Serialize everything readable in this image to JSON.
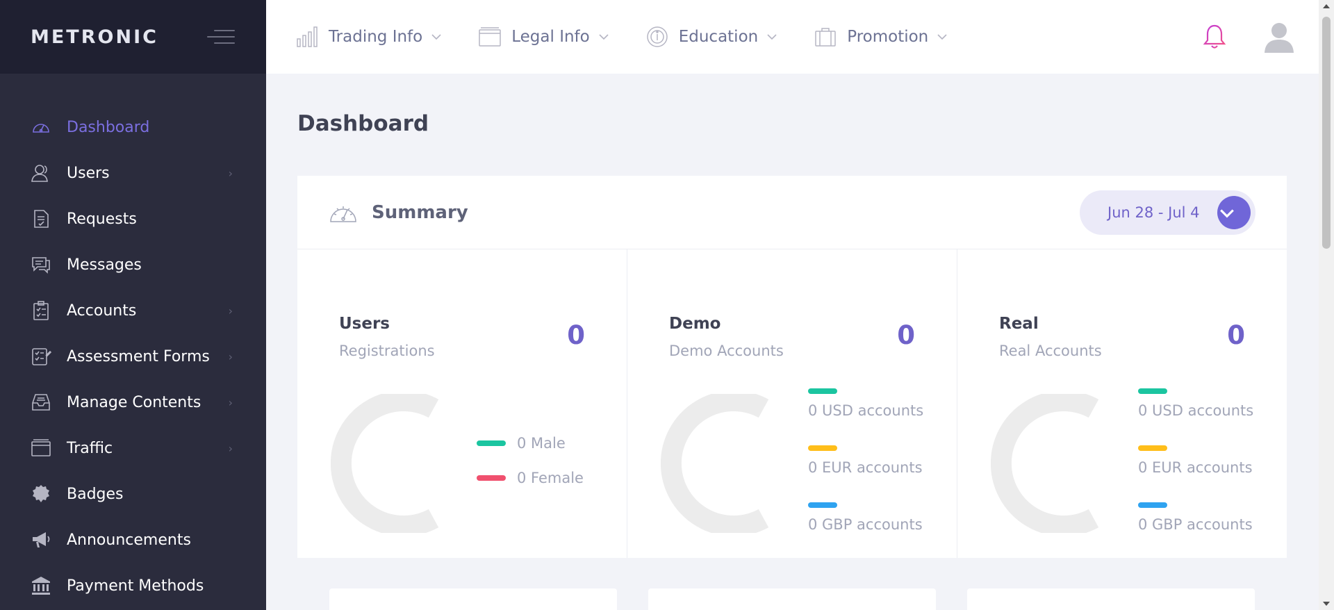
{
  "brand": {
    "name": "METRONIC"
  },
  "sidebar": {
    "items": [
      {
        "label": "Dashboard",
        "icon": "dashboard-gauge-icon",
        "active": true,
        "has_submenu": false
      },
      {
        "label": "Users",
        "icon": "users-icon",
        "active": false,
        "has_submenu": true
      },
      {
        "label": "Requests",
        "icon": "requests-document-icon",
        "active": false,
        "has_submenu": false
      },
      {
        "label": "Messages",
        "icon": "messages-chat-icon",
        "active": false,
        "has_submenu": false
      },
      {
        "label": "Accounts",
        "icon": "accounts-clipboard-icon",
        "active": false,
        "has_submenu": true
      },
      {
        "label": "Assessment Forms",
        "icon": "assessment-form-icon",
        "active": false,
        "has_submenu": true
      },
      {
        "label": "Manage Contents",
        "icon": "inbox-tray-icon",
        "active": false,
        "has_submenu": true
      },
      {
        "label": "Traffic",
        "icon": "traffic-window-icon",
        "active": false,
        "has_submenu": true
      },
      {
        "label": "Badges",
        "icon": "badge-seal-icon",
        "active": false,
        "has_submenu": false
      },
      {
        "label": "Announcements",
        "icon": "megaphone-icon",
        "active": false,
        "has_submenu": false
      },
      {
        "label": "Payment Methods",
        "icon": "bank-icon",
        "active": false,
        "has_submenu": false
      }
    ],
    "arrow_glyph": "›"
  },
  "topbar": {
    "nav": [
      {
        "label": "Trading Info",
        "icon": "bar-chart-icon"
      },
      {
        "label": "Legal Info",
        "icon": "legal-window-icon"
      },
      {
        "label": "Education",
        "icon": "education-info-icon"
      },
      {
        "label": "Promotion",
        "icon": "briefcase-icon"
      }
    ],
    "bell_icon": "notification-bell-icon",
    "avatar_icon": "user-avatar-icon"
  },
  "page": {
    "title": "Dashboard"
  },
  "summary": {
    "title": "Summary",
    "date_range": "Jun 28 - Jul 4",
    "stats": [
      {
        "title": "Users",
        "subtitle": "Registrations",
        "value": "0",
        "legend": [
          {
            "label": "0 Male",
            "color": "#1bc5a0"
          },
          {
            "label": "0 Female",
            "color": "#f0506e"
          }
        ]
      },
      {
        "title": "Demo",
        "subtitle": "Demo Accounts",
        "value": "0",
        "legend": [
          {
            "label": "0 USD accounts",
            "color": "#1bc5a0"
          },
          {
            "label": "0 EUR accounts",
            "color": "#ffbe1a"
          },
          {
            "label": "0 GBP accounts",
            "color": "#2fa3f0"
          }
        ]
      },
      {
        "title": "Real",
        "subtitle": "Real Accounts",
        "value": "0",
        "legend": [
          {
            "label": "0 USD accounts",
            "color": "#1bc5a0"
          },
          {
            "label": "0 EUR accounts",
            "color": "#ffbe1a"
          },
          {
            "label": "0 GBP accounts",
            "color": "#2fa3f0"
          }
        ]
      }
    ]
  },
  "colors": {
    "accent": "#6f62c9",
    "sidebar_bg": "#2b2c3d",
    "page_bg": "#f2f3f8"
  }
}
